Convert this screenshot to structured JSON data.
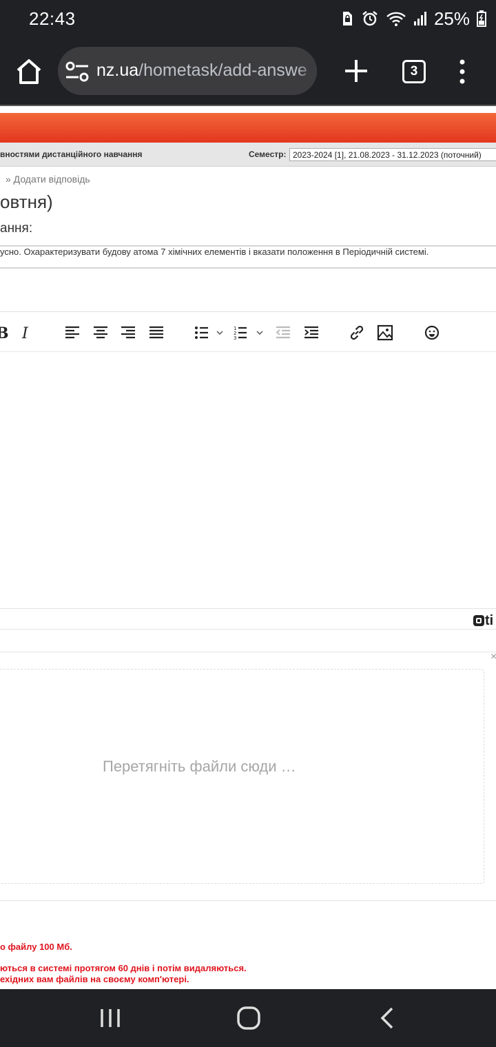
{
  "status_bar": {
    "time": "22:43",
    "battery": "25%",
    "icons": [
      "sim-lock-icon",
      "alarm-icon",
      "wifi-icon",
      "signal-icon",
      "battery-icon"
    ]
  },
  "browser": {
    "url_host": "nz.ua",
    "url_path": "/hometask/add-answe",
    "tab_count": "3"
  },
  "site": {
    "header_left": "вностями дистанційного навчання",
    "semester_label": "Семестр:",
    "semester_value": "2023-2024 [1], 21.08.2023 - 31.12.2023 (поточний)",
    "breadcrumb": "» Додати відповідь",
    "title": "овтня)",
    "subtitle": "ання:",
    "task_text": "усно. Охарактеризувати будову атома 7 хімічних елементів і вказати положення в Періодичній системі."
  },
  "editor": {
    "toolbar": [
      "bold",
      "italic",
      "align-left",
      "align-center",
      "align-right",
      "justify",
      "bullet-list",
      "numbered-list",
      "outdent",
      "indent",
      "link",
      "image",
      "emoticons"
    ],
    "logo_text": "ti"
  },
  "upload": {
    "close": "×",
    "drop_text": "Перетягніть файли сюди …"
  },
  "notes": {
    "line1": "о файлу 100 Мб.",
    "line2": "ються в системі протягом 60 днів і потім видаляються.",
    "line3": "ехідних вам файлів на своєму комп'ютері."
  },
  "colors": {
    "accent_orange": "#e8452a",
    "note_red": "#e0141e",
    "system_bar": "#202124"
  }
}
